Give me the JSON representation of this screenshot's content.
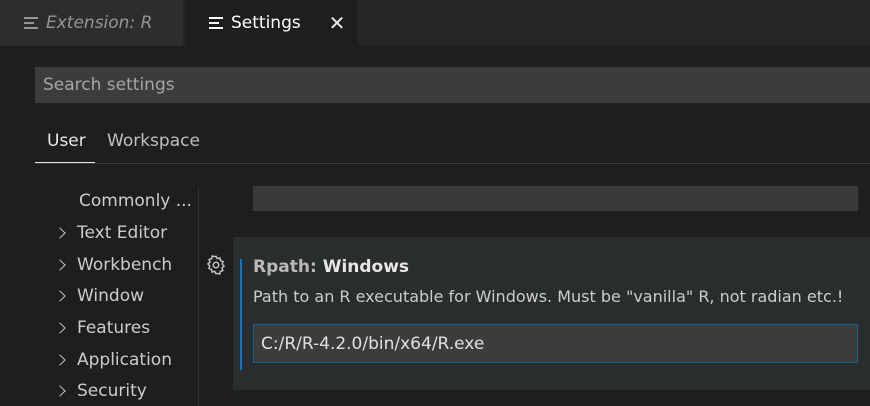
{
  "tabs": [
    {
      "label": "Extension: R",
      "active": false
    },
    {
      "label": "Settings",
      "active": true
    }
  ],
  "tab_close_glyph": "✕",
  "search": {
    "placeholder": "Search settings",
    "value": ""
  },
  "scope_tabs": {
    "user": "User",
    "workspace": "Workspace",
    "selected": "User"
  },
  "toc": {
    "commonly_used": "Commonly ...",
    "items": [
      "Text Editor",
      "Workbench",
      "Window",
      "Features",
      "Application",
      "Security"
    ]
  },
  "setting": {
    "category": "Rpath: ",
    "name": "Windows",
    "description": "Path to an R executable for Windows. Must be \"vanilla\" R, not radian etc.!",
    "value": "C:/R/R-4.2.0/bin/x64/R.exe"
  },
  "colors": {
    "accent": "#0078d4",
    "background": "#1e1e1e",
    "tabbar": "#252526",
    "input": "#3c3c3c"
  }
}
